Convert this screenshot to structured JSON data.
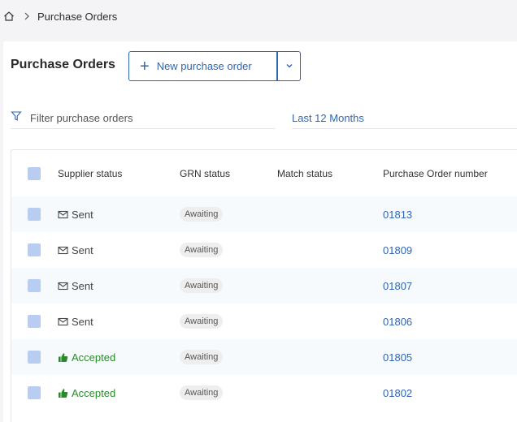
{
  "breadcrumb": {
    "current": "Purchase Orders"
  },
  "header": {
    "title": "Purchase Orders",
    "new_button_label": "New purchase order"
  },
  "filter": {
    "placeholder": "Filter purchase orders",
    "value": ""
  },
  "date_range": {
    "label": "Last 12 Months"
  },
  "table": {
    "columns": {
      "supplier_status": "Supplier status",
      "grn_status": "GRN status",
      "match_status": "Match status",
      "po_number": "Purchase Order number"
    },
    "rows": [
      {
        "supplier_status": "Sent",
        "grn_status": "Awaiting",
        "match_status": "",
        "po_number": "01813"
      },
      {
        "supplier_status": "Sent",
        "grn_status": "Awaiting",
        "match_status": "",
        "po_number": "01809"
      },
      {
        "supplier_status": "Sent",
        "grn_status": "Awaiting",
        "match_status": "",
        "po_number": "01807"
      },
      {
        "supplier_status": "Sent",
        "grn_status": "Awaiting",
        "match_status": "",
        "po_number": "01806"
      },
      {
        "supplier_status": "Accepted",
        "grn_status": "Awaiting",
        "match_status": "",
        "po_number": "01805"
      },
      {
        "supplier_status": "Accepted",
        "grn_status": "Awaiting",
        "match_status": "",
        "po_number": "01802"
      }
    ]
  },
  "colors": {
    "accent": "#2f66b3",
    "accepted": "#2a8a2a",
    "checkbox": "#b9cdf3"
  },
  "icons": {
    "home": "home-icon",
    "separator": "chevron-right-icon",
    "add": "plus-icon",
    "dropdown": "chevron-down-icon",
    "filter": "filter-icon",
    "sent": "envelope-icon",
    "accepted": "thumbs-up-icon"
  }
}
